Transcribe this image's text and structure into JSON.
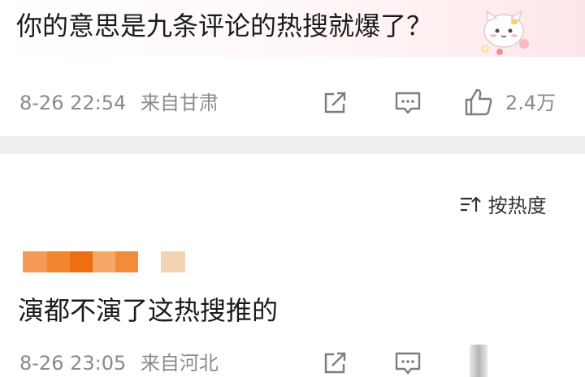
{
  "top_comment": {
    "text": "你的意思是九条评论的热搜就爆了？",
    "date": "8-26 22:54",
    "location": "来自甘肃",
    "like_count": "2.4万",
    "icons": [
      "share-icon",
      "comment-icon",
      "like-icon"
    ]
  },
  "sort": {
    "icon": "sort-icon",
    "label": "按热度"
  },
  "reply": {
    "text": "演都不演了这热搜推的",
    "date": "8-26 23:05",
    "location": "来自河北",
    "icons": [
      "share-icon",
      "comment-icon"
    ]
  },
  "colors": {
    "text_main": "#1a1a1a",
    "text_meta": "#8a8a8a",
    "divider": "#efefef",
    "username_blur_orange": "#f07a1c",
    "username_blur_light": "#f6b07b"
  }
}
